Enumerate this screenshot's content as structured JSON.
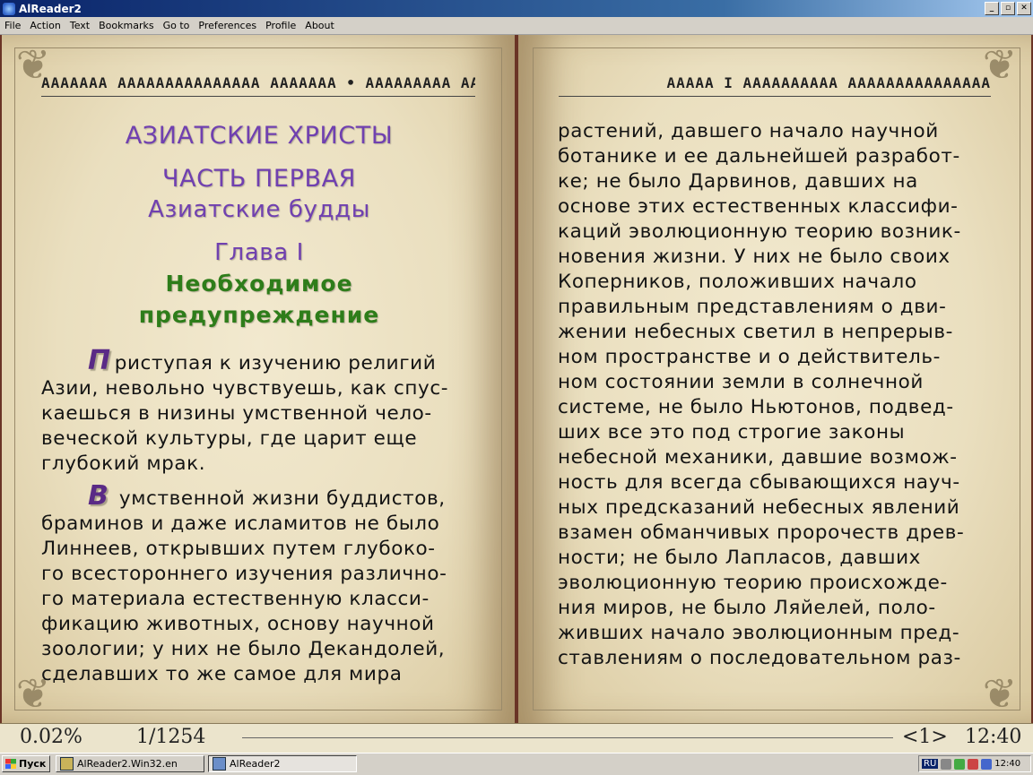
{
  "window": {
    "title": "AlReader2",
    "buttons": [
      "_",
      "▫",
      "✕"
    ]
  },
  "menu": [
    "File",
    "Action",
    "Text",
    "Bookmarks",
    "Go to",
    "Preferences",
    "Profile",
    "About"
  ],
  "left_page": {
    "header": "ААААААА ААААААААААААААА ААААААА  • ААААААААА ААААААА",
    "book_title": "АЗИАТСКИЕ ХРИСТЫ",
    "part_title": "ЧАСТЬ ПЕРВАЯ",
    "part_subtitle": "Азиатские будды",
    "chapter": "Глава I",
    "chapter_name_1": "Необходимое",
    "chapter_name_2": "предупреждение",
    "p1_cap": "П",
    "p1_lines": [
      "риступая к изучению религий",
      "Азии, невольно чувствуешь, как спус-",
      "каешься в низины умственной чело-",
      "веческой культуры, где царит еще",
      "глубокий мрак."
    ],
    "p2_cap": "В",
    "p2_lines": [
      "умственной жизни буддистов,",
      "браминов и даже исламитов не было",
      "Линнеев, открывших путем глубоко-",
      "го всестороннего изучения различно-",
      "го материала естественную класси-",
      "фикацию животных, основу научной",
      "зоологии; у них не было Декандолей,",
      "сделавших то же самое для мира"
    ]
  },
  "right_page": {
    "header": "ААААА I АААААААААА ААААААААААААААА",
    "lines": [
      "растений, давшего начало научной",
      "ботанике и ее дальнейшей разработ-",
      "ке; не было Дарвинов, давших на",
      "основе этих естественных классифи-",
      "каций эволюционную теорию возник-",
      "новения жизни. У них не было своих",
      "Коперников, положивших начало",
      "правильным представлениям о дви-",
      "жении небесных светил в непрерыв-",
      "ном пространстве и о действитель-",
      "ном состоянии земли в солнечной",
      "системе, не было Ньютонов, подвед-",
      "ших все это под строгие законы",
      "небесной механики, давшие возмож-",
      "ность для всегда сбывающихся науч-",
      "ных предсказаний небесных явлений",
      "взамен обманчивых пророчеств древ-",
      "ности; не было Лапласов, давших",
      "эволюционную теорию происхожде-",
      "ния миров, не было Ляйелей, поло-",
      "живших начало эволюционным пред-",
      "ставлениям о последовательном раз-"
    ]
  },
  "status": {
    "percent": "0.02%",
    "pages": "1/1254",
    "page_marker": "<1>",
    "clock": "12:40"
  },
  "taskbar": {
    "start_label": "Пуск",
    "tasks": [
      "AlReader2.Win32.en",
      "AlReader2"
    ],
    "lang": "RU",
    "time": "12:40"
  }
}
